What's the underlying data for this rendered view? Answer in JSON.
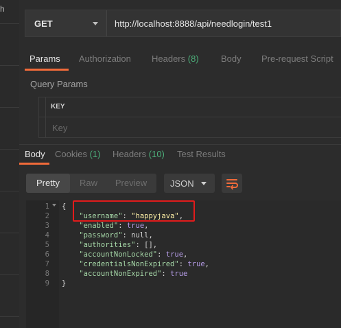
{
  "left_panel": {
    "fragment": "h"
  },
  "request": {
    "method": "GET",
    "url": "http://localhost:8888/api/needlogin/test1"
  },
  "request_tabs": [
    {
      "label": "Params"
    },
    {
      "label": "Authorization"
    },
    {
      "label": "Headers",
      "count": "(8)"
    },
    {
      "label": "Body"
    },
    {
      "label": "Pre-request Script"
    }
  ],
  "query_params": {
    "title": "Query Params",
    "key_header": "KEY",
    "key_placeholder": "Key"
  },
  "response_tabs": [
    {
      "label": "Body"
    },
    {
      "label": "Cookies",
      "count": "(1)"
    },
    {
      "label": "Headers",
      "count": "(10)"
    },
    {
      "label": "Test Results"
    }
  ],
  "view_modes": [
    "Pretty",
    "Raw",
    "Preview"
  ],
  "format": "JSON",
  "wrap_icon": "wrap-lines-icon",
  "colors": {
    "accent": "#f26b3a",
    "count": "#4caf7a",
    "highlight": "#e21b1b"
  },
  "code": {
    "line_numbers": [
      "1",
      "2",
      "3",
      "4",
      "5",
      "6",
      "7",
      "8",
      "9"
    ],
    "lines": [
      [
        {
          "t": "{",
          "c": "p"
        }
      ],
      [
        {
          "t": "    ",
          "c": "p"
        },
        {
          "t": "\"username\"",
          "c": "k"
        },
        {
          "t": ": ",
          "c": "p"
        },
        {
          "t": "\"happyjava\"",
          "c": "s"
        },
        {
          "t": ",",
          "c": "p"
        }
      ],
      [
        {
          "t": "    ",
          "c": "p"
        },
        {
          "t": "\"enabled\"",
          "c": "k"
        },
        {
          "t": ": ",
          "c": "p"
        },
        {
          "t": "true",
          "c": "v"
        },
        {
          "t": ",",
          "c": "p"
        }
      ],
      [
        {
          "t": "    ",
          "c": "p"
        },
        {
          "t": "\"password\"",
          "c": "k"
        },
        {
          "t": ": null,",
          "c": "p"
        }
      ],
      [
        {
          "t": "    ",
          "c": "p"
        },
        {
          "t": "\"authorities\"",
          "c": "k"
        },
        {
          "t": ": [],",
          "c": "p"
        }
      ],
      [
        {
          "t": "    ",
          "c": "p"
        },
        {
          "t": "\"accountNonLocked\"",
          "c": "k"
        },
        {
          "t": ": ",
          "c": "p"
        },
        {
          "t": "true",
          "c": "v"
        },
        {
          "t": ",",
          "c": "p"
        }
      ],
      [
        {
          "t": "    ",
          "c": "p"
        },
        {
          "t": "\"credentialsNonExpired\"",
          "c": "k"
        },
        {
          "t": ": ",
          "c": "p"
        },
        {
          "t": "true",
          "c": "v"
        },
        {
          "t": ",",
          "c": "p"
        }
      ],
      [
        {
          "t": "    ",
          "c": "p"
        },
        {
          "t": "\"accountNonExpired\"",
          "c": "k"
        },
        {
          "t": ": ",
          "c": "p"
        },
        {
          "t": "true",
          "c": "v"
        }
      ],
      [
        {
          "t": "}",
          "c": "p"
        }
      ]
    ]
  }
}
